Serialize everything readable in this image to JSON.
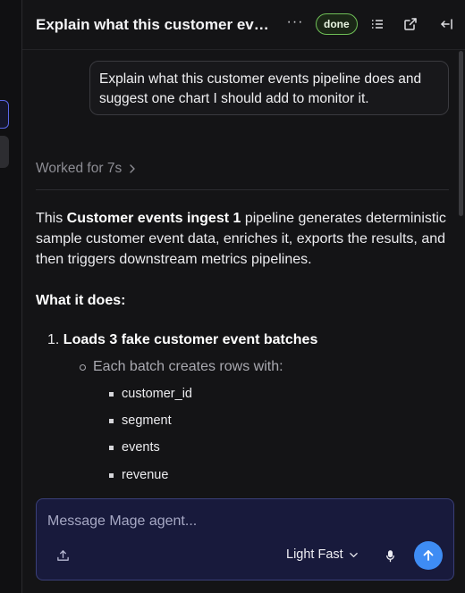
{
  "header": {
    "title": "Explain what this customer events pipeline does and suggest one chart I should add to monitor it.",
    "more_label": "···",
    "status_badge": "done"
  },
  "conversation": {
    "user_message": "Explain what this customer events pipeline does and suggest one chart I should add to monitor it.",
    "worked_for": "Worked for 7s",
    "answer": {
      "intro_prefix": "This ",
      "pipeline_name": "Customer events ingest 1",
      "intro_suffix": " pipeline generates deterministic sample customer event data, enriches it, exports the results, and then triggers downstream metrics pipelines.",
      "what_it_does": "What it does:",
      "step_1_number": "1.",
      "step_1": "Loads 3 fake customer event batches",
      "step_1_detail": "Each batch creates rows with:",
      "fields": [
        "customer_id",
        "segment",
        "events",
        "revenue"
      ]
    }
  },
  "composer": {
    "placeholder": "Message Mage agent...",
    "model_label": "Light Fast"
  },
  "icons": {
    "list": "list-icon",
    "external": "external-link-icon",
    "collapse": "collapse-panel-icon",
    "chevron": "chevron-right-icon",
    "attach": "upload-icon",
    "mic": "microphone-icon",
    "send": "arrow-up-icon"
  },
  "colors": {
    "accent": "#3e8cf4",
    "badge_border": "#6fbf57",
    "composer_bg": "#181a3c"
  }
}
